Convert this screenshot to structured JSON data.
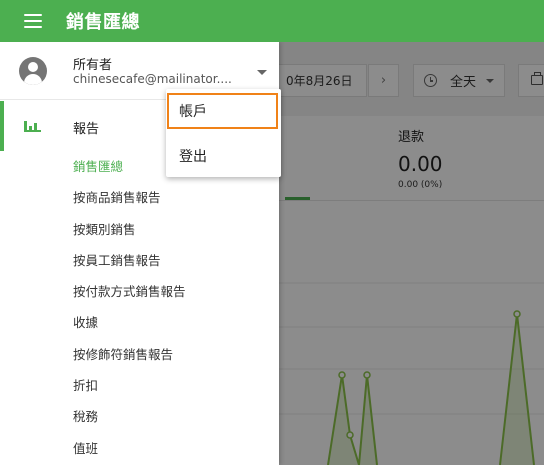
{
  "app": {
    "title": "銷售匯總"
  },
  "toolbar": {
    "date_text": "0年8月26日",
    "next_glyph": "›",
    "range_label": "全天"
  },
  "summary": {
    "refund_label": "退款",
    "refund_value": "0.00",
    "refund_pct": "0.00 (0%)"
  },
  "colors": {
    "brand": "#4caf50",
    "highlight": "#f08218"
  },
  "drawer": {
    "owner_name": "所有者",
    "owner_email": "chinesecafe@mailinator....",
    "report_label": "報告",
    "sub_items": [
      "銷售匯總",
      "按商品銷售報告",
      "按類別銷售",
      "按員工銷售報告",
      "按付款方式銷售報告",
      "收據",
      "按修飾符銷售報告",
      "折扣",
      "稅務",
      "值班"
    ]
  },
  "menu": {
    "items": [
      "帳戶",
      "登出"
    ]
  }
}
